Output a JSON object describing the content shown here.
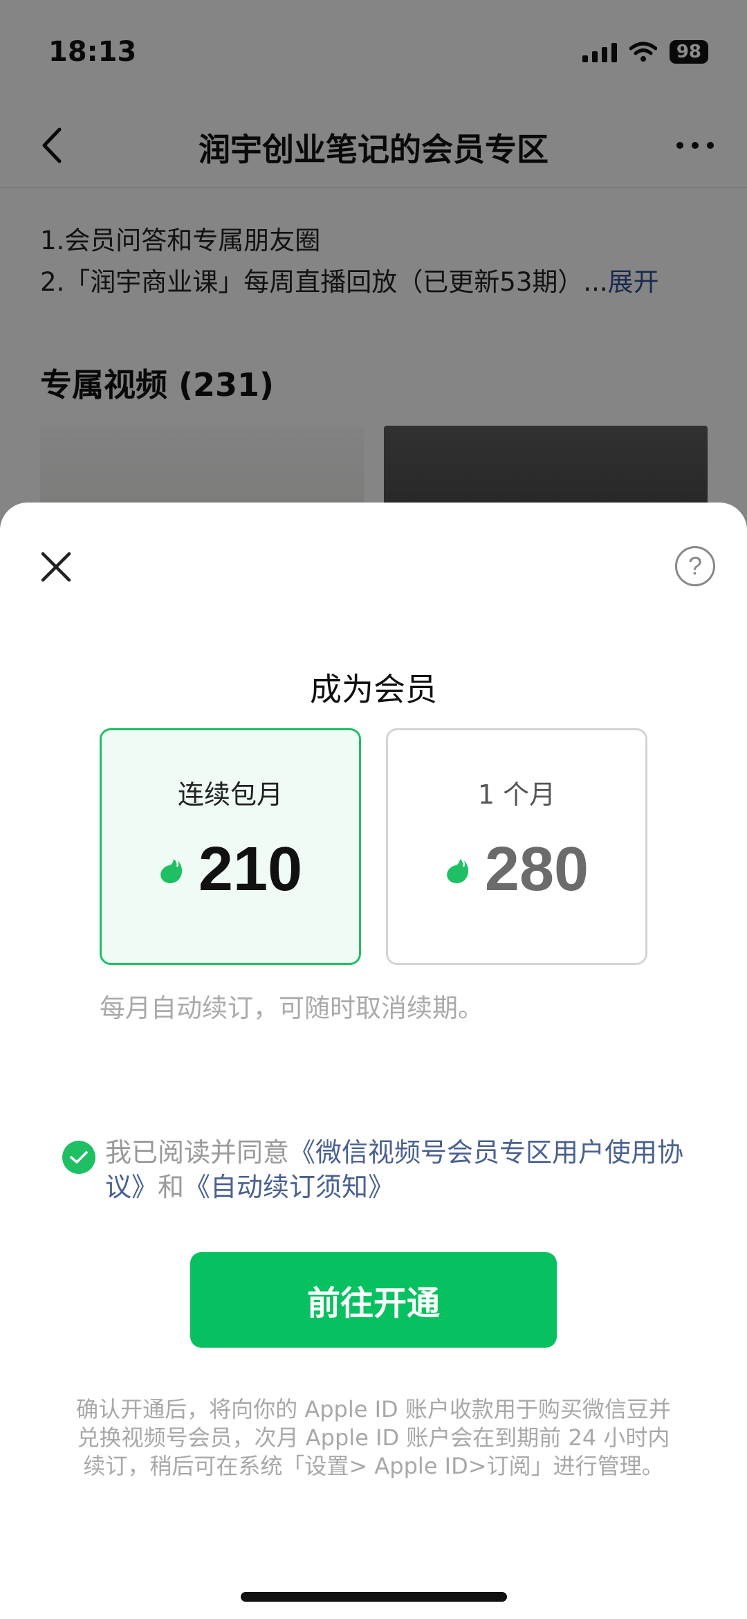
{
  "status_bar": {
    "time": "18:13",
    "battery": "98"
  },
  "nav": {
    "title": "润宇创业笔记的会员专区"
  },
  "description": {
    "line1": "1.会员问答和专属朋友圈",
    "line2": "2.「润宇商业课」每周直播回放（已更新53期）...",
    "expand": "展开"
  },
  "section": {
    "title": "专属视频 (231)"
  },
  "sheet": {
    "title": "成为会员",
    "help_symbol": "?",
    "plans": [
      {
        "name": "连续包月",
        "price": "210",
        "selected": true
      },
      {
        "name": "1 个月",
        "price": "280",
        "selected": false
      }
    ],
    "renew_note": "每月自动续订，可随时取消续期。",
    "agreement": {
      "prefix": "我已阅读并同意",
      "link1": "《微信视频号会员专区用户使用协议》",
      "middle": "和",
      "link2": "《自动续订须知》",
      "checked": true
    },
    "open_button": "前往开通",
    "footer_note": "确认开通后，将向你的 Apple ID 账户收款用于购买微信豆并兑换视频号会员，次月 Apple ID 账户会在到期前 24 小时内续订，稍后可在系统「设置> Apple ID>订阅」进行管理。"
  },
  "colors": {
    "accent": "#07c160",
    "selected_bg": "#effbf4",
    "link": "#4a6190"
  },
  "icons": [
    "back-icon",
    "more-icon",
    "close-icon",
    "help-icon",
    "bean-icon",
    "check-icon"
  ]
}
